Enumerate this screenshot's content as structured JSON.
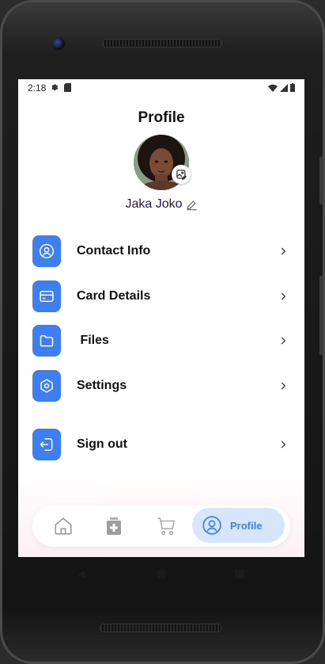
{
  "status_bar": {
    "time": "2:18",
    "left_icons": [
      "gear-icon",
      "sd-card-icon"
    ],
    "right_icons": [
      "wifi-icon",
      "signal-icon",
      "battery-icon"
    ]
  },
  "profile": {
    "title": "Profile",
    "user_name": "Jaka Joko"
  },
  "menu": [
    {
      "label": "Contact Info",
      "icon": "user-circle-icon"
    },
    {
      "label": "Card Details",
      "icon": "card-icon"
    },
    {
      "label": " Files",
      "icon": "folder-icon"
    },
    {
      "label": "Settings",
      "icon": "hexagon-settings-icon"
    },
    {
      "label": "Sign out",
      "icon": "sign-out-icon"
    }
  ],
  "bottom_nav": {
    "items": [
      {
        "icon": "home-icon"
      },
      {
        "icon": "medical-bag-icon"
      },
      {
        "icon": "cart-icon"
      },
      {
        "icon": "profile-icon",
        "label": "Profile",
        "active": true
      }
    ]
  },
  "colors": {
    "accent": "#3d7ff3",
    "active_pill": "#d6e6fb",
    "name_color": "#2a1450"
  }
}
